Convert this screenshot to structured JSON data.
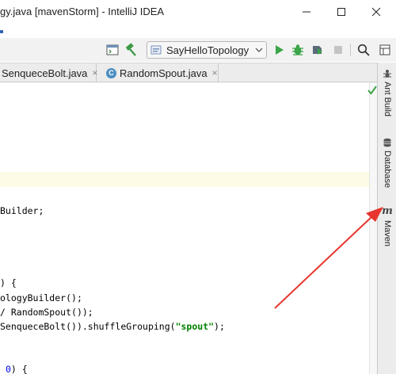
{
  "window": {
    "title": "gy.java [mavenStorm] - IntelliJ IDEA"
  },
  "toolbar": {
    "run_config": "SayHelloTopology"
  },
  "tabs": [
    {
      "label": "SenqueceBolt.java",
      "close": "×"
    },
    {
      "label": "RandomSpout.java",
      "close": "×",
      "icon": "C"
    }
  ],
  "code": {
    "l1": "Builder;",
    "l2": ") {",
    "l3a": "ologyBuilder",
    "l3b": "();",
    "l4a": "/ RandomSpout",
    "l4b": "());",
    "l5a": "SenqueceBolt",
    "l5b": "()).shuffleGrouping(",
    "l5c": "\"spout\"",
    "l5d": ");",
    "l6a": "0",
    "l6b": ") {"
  },
  "sidebar": {
    "ant": "Ant Build",
    "database": "Database",
    "maven": "Maven",
    "maven_glyph": "m"
  },
  "colors": {
    "arrow": "#e8352f",
    "run_green": "#3ba548",
    "highlight": "#fdfbe5"
  }
}
